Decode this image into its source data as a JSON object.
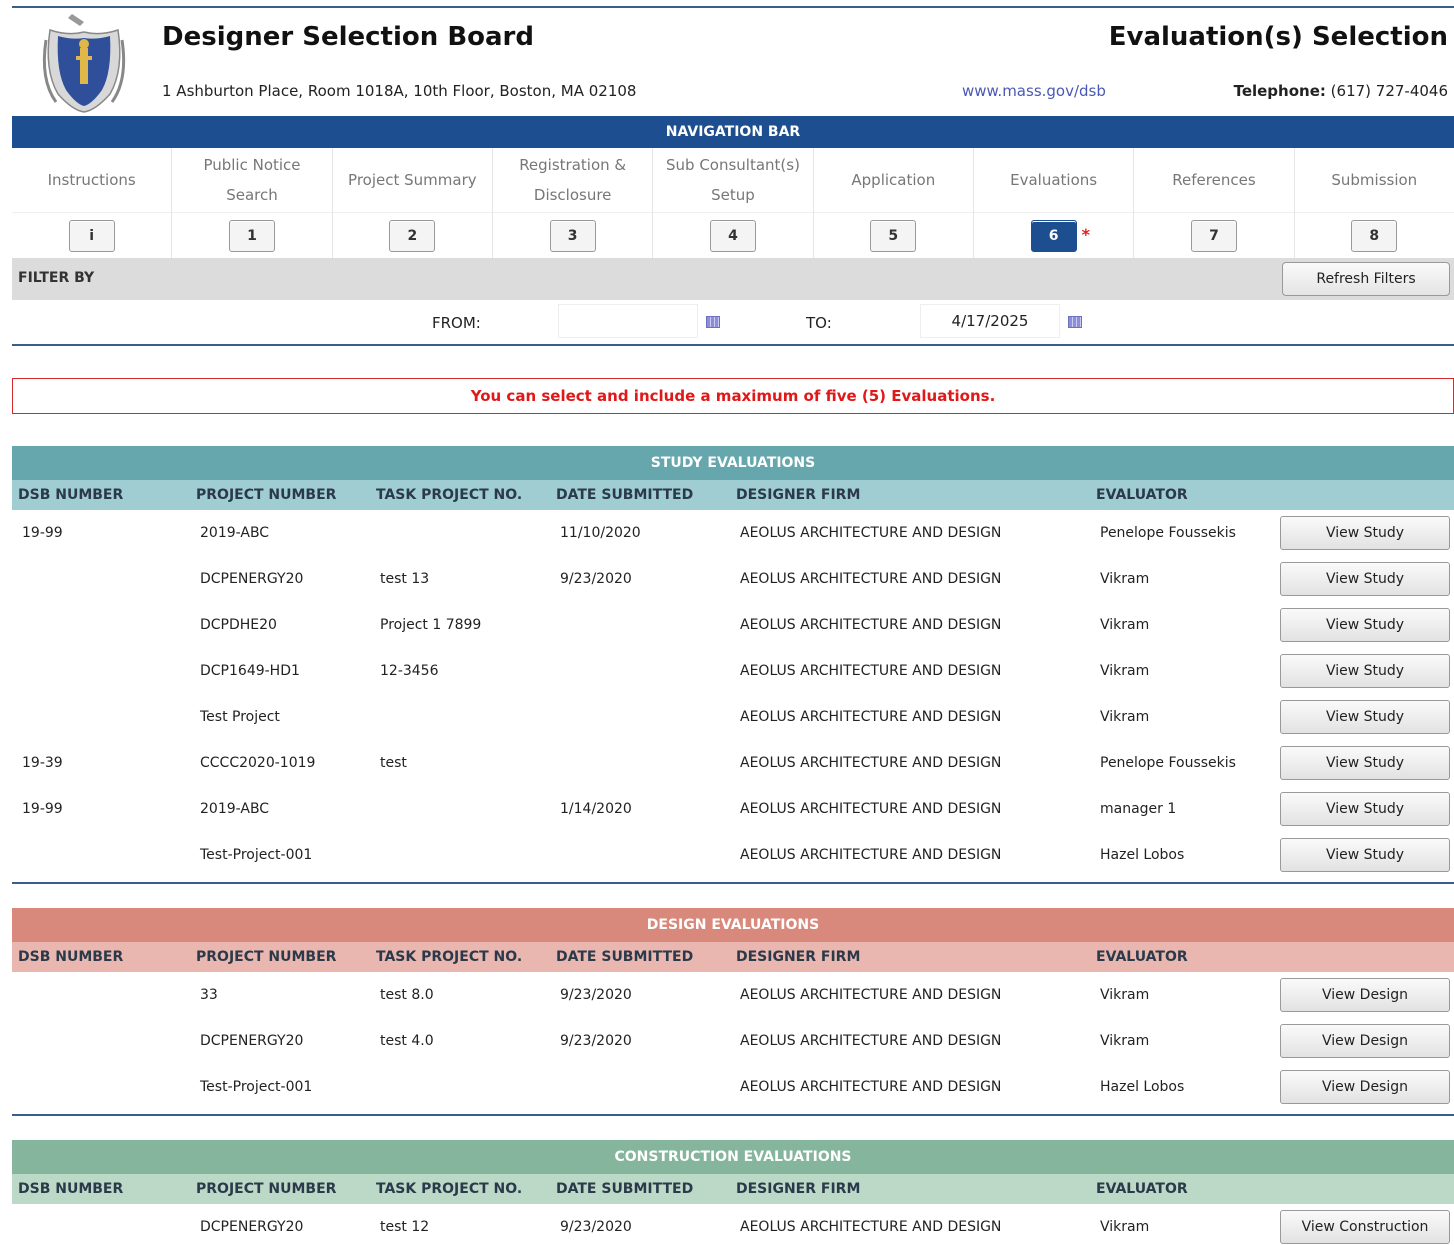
{
  "header": {
    "org_title": "Designer Selection Board",
    "page_title": "Evaluation(s) Selection",
    "address": "1 Ashburton Place, Room 1018A, 10th Floor, Boston, MA 02108",
    "website": "www.mass.gov/dsb",
    "phone_label": "Telephone:",
    "phone_number": "(617) 727-4046"
  },
  "nav": {
    "title": "NAVIGATION BAR",
    "items": [
      {
        "label": "Instructions",
        "step": "i",
        "active": false
      },
      {
        "label": "Public Notice Search",
        "step": "1",
        "active": false
      },
      {
        "label": "Project Summary",
        "step": "2",
        "active": false
      },
      {
        "label": "Registration & Disclosure",
        "step": "3",
        "active": false
      },
      {
        "label": "Sub Consultant(s) Setup",
        "step": "4",
        "active": false
      },
      {
        "label": "Application",
        "step": "5",
        "active": false
      },
      {
        "label": "Evaluations",
        "step": "6",
        "active": true
      },
      {
        "label": "References",
        "step": "7",
        "active": false
      },
      {
        "label": "Submission",
        "step": "8",
        "active": false
      }
    ],
    "required_marker": "*"
  },
  "filter": {
    "label": "FILTER BY",
    "refresh_label": "Refresh Filters",
    "from_label": "FROM:",
    "from_value": "",
    "to_label": "TO:",
    "to_value": "4/17/2025"
  },
  "notice": "You can select and include a maximum of five (5) Evaluations.",
  "columns": [
    "DSB NUMBER",
    "PROJECT NUMBER",
    "TASK PROJECT NO.",
    "DATE SUBMITTED",
    "DESIGNER FIRM",
    "EVALUATOR"
  ],
  "sections": {
    "study": {
      "title": "STUDY EVALUATIONS",
      "button_label": "View Study",
      "rows": [
        [
          "19-99",
          "2019-ABC",
          "",
          "11/10/2020",
          "AEOLUS ARCHITECTURE AND DESIGN",
          "Penelope Foussekis"
        ],
        [
          "",
          "DCPENERGY20",
          "test 13",
          "9/23/2020",
          "AEOLUS ARCHITECTURE AND DESIGN",
          "Vikram"
        ],
        [
          "",
          "DCPDHE20",
          "Project 1 7899",
          "",
          "AEOLUS ARCHITECTURE AND DESIGN",
          "Vikram"
        ],
        [
          "",
          "DCP1649-HD1",
          "12-3456",
          "",
          "AEOLUS ARCHITECTURE AND DESIGN",
          "Vikram"
        ],
        [
          "",
          "Test Project",
          "",
          "",
          "AEOLUS ARCHITECTURE AND DESIGN",
          "Vikram"
        ],
        [
          "19-39",
          "CCCC2020-1019",
          "test",
          "",
          "AEOLUS ARCHITECTURE AND DESIGN",
          "Penelope Foussekis"
        ],
        [
          "19-99",
          "2019-ABC",
          "",
          "1/14/2020",
          "AEOLUS ARCHITECTURE AND DESIGN",
          "manager 1"
        ],
        [
          "",
          "Test-Project-001",
          "",
          "",
          "AEOLUS ARCHITECTURE AND DESIGN",
          "Hazel Lobos"
        ]
      ]
    },
    "design": {
      "title": "DESIGN EVALUATIONS",
      "button_label": "View Design",
      "rows": [
        [
          "",
          "33",
          "test 8.0",
          "9/23/2020",
          "AEOLUS ARCHITECTURE AND DESIGN",
          "Vikram"
        ],
        [
          "",
          "DCPENERGY20",
          "test 4.0",
          "9/23/2020",
          "AEOLUS ARCHITECTURE AND DESIGN",
          "Vikram"
        ],
        [
          "",
          "Test-Project-001",
          "",
          "",
          "AEOLUS ARCHITECTURE AND DESIGN",
          "Hazel Lobos"
        ]
      ]
    },
    "construction": {
      "title": "CONSTRUCTION EVALUATIONS",
      "button_label": "View Construction",
      "rows": [
        [
          "",
          "DCPENERGY20",
          "test 12",
          "9/23/2020",
          "AEOLUS ARCHITECTURE AND DESIGN",
          "Vikram"
        ]
      ]
    }
  },
  "colors": {
    "nav_blue": "#1d4e8f",
    "study_header": "#66a6ad",
    "design_header": "#d9887c",
    "construction_header": "#85b59c",
    "notice_red": "#e01818"
  }
}
